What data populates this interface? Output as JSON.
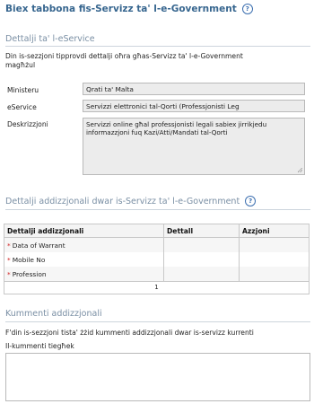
{
  "page": {
    "title": "Biex tabbona fis-Servizz ta' l-e-Government",
    "help_icon": "help-icon"
  },
  "eservice_details": {
    "title": "Dettalji ta' l-eService",
    "intro": "Din is-sezzjoni tipprovdi dettalji oħra għas-Servizz ta' l-e-Government",
    "intro_line2": "magħżul",
    "ministry_label": "Ministeru",
    "ministry_value": "Qrati ta' Malta",
    "eservice_label": "eService",
    "eservice_value": "Servizzi elettronici tal-Qorti (Professjonisti Leg",
    "description_label": "Deskrizzjoni",
    "description_value_line1": "Servizzi online għal professjonisti legali sabiex jirrikjedu",
    "description_value_line2": "informazzjoni fuq Kazi/Atti/Mandati tal-Qorti"
  },
  "additional_details": {
    "title": "Dettalji addizzjonali dwar is-Servizz ta' l-e-Government",
    "columns": [
      "Dettalji addizzjonali",
      "Dettall",
      "Azzjoni"
    ],
    "rows": [
      {
        "label": "Data of Warrant",
        "detail": "",
        "action": ""
      },
      {
        "label": "Mobile No",
        "detail": "",
        "action": ""
      },
      {
        "label": "Profession",
        "detail": "",
        "action": ""
      }
    ],
    "page_number": "1"
  },
  "comments": {
    "title": "Kummenti addizzjonali",
    "intro": "F'din is-sezzjoni tista' żżid kummenti addizzjonali dwar is-servizz kurrenti",
    "label": "Il-kummenti tiegħek",
    "value": ""
  },
  "colors": {
    "title_blue": "#37668f",
    "section_gray": "#7a8fa4",
    "required_red": "#d02020",
    "field_bg": "#ececec"
  }
}
